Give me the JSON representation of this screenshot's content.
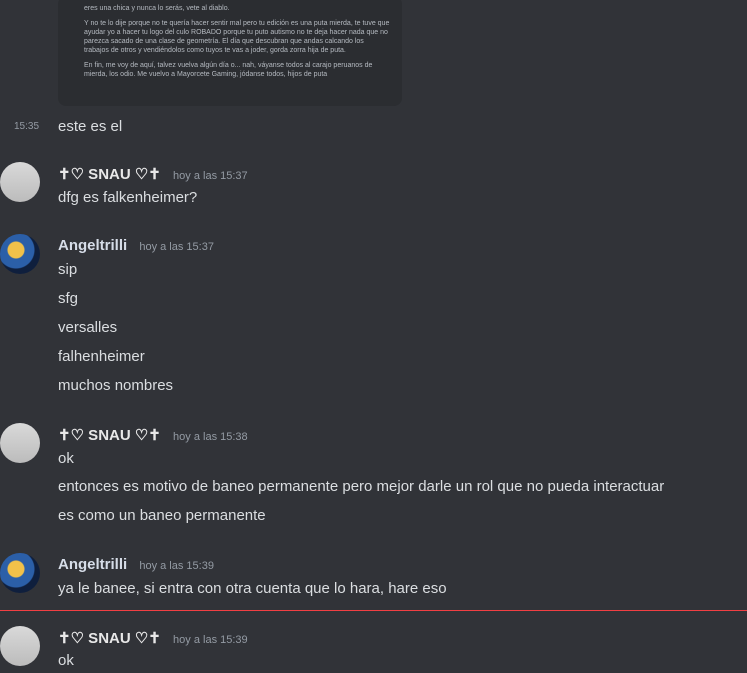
{
  "embed": {
    "line0": "eres una chica y nunca lo serás, vete al diablo.",
    "para1": "Y no te lo dije porque no te quería hacer sentir mal pero tu edición es una puta mierda, te tuve que ayudar yo a hacer tu logo del culo ROBADO porque tu puto autismo no te deja hacer nada que no parezca sacado de una clase de geometría. El día que descubran que andas calcando los trabajos de otros y vendiéndolos como tuyos te vas a joder, gorda zorra hija de puta.",
    "para2": "En fin, me voy de aquí, talvez vuelva algún día o... nah, váyanse todos al carajo peruanos de mierda, los odio. Me vuelvo a Mayorcete Gaming, jódanse todos, hijos de puta"
  },
  "side_time": "15:35",
  "first_line": "este es el",
  "messages": [
    {
      "user": "✝♡ SNAU ♡✝",
      "time": "hoy a las 15:37",
      "lines": [
        "dfg es falkenheimer?"
      ]
    },
    {
      "user": "Angeltrilli",
      "time": "hoy a las 15:37",
      "lines": [
        "sip",
        "sfg",
        "versalles",
        "falhenheimer",
        "muchos nombres"
      ]
    },
    {
      "user": "✝♡ SNAU ♡✝",
      "time": "hoy a las 15:38",
      "lines": [
        "ok",
        "entonces es motivo de baneo permanente pero mejor darle un rol que no pueda interactuar",
        "es como un baneo permanente"
      ]
    },
    {
      "user": "Angeltrilli",
      "time": "hoy a las 15:39",
      "lines": [
        "ya le banee, si entra con otra cuenta que lo hara, hare eso"
      ]
    },
    {
      "user": "✝♡ SNAU ♡✝",
      "time": "hoy a las 15:39",
      "lines": [
        "ok"
      ]
    }
  ]
}
